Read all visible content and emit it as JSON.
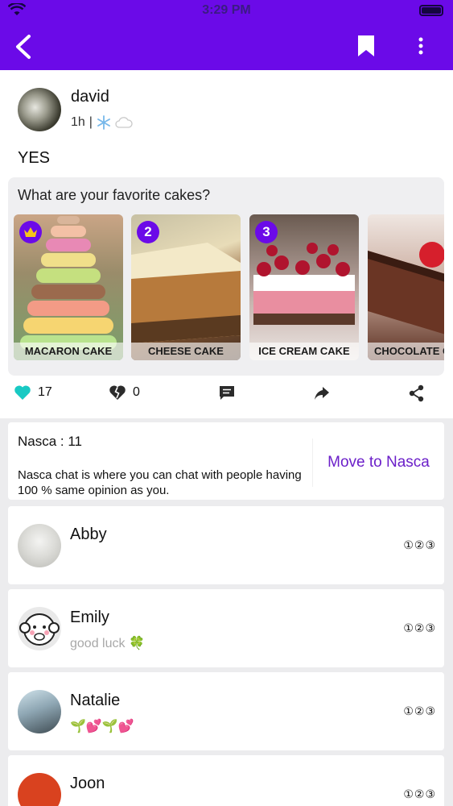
{
  "status_bar": {
    "time": "3:29 PM"
  },
  "nav": {
    "back_icon": "chevron-left-icon",
    "bookmark_icon": "bookmark-icon",
    "more_icon": "more-vertical-icon"
  },
  "post": {
    "author": "david",
    "time": "1h",
    "separator": "|",
    "weather_icons": [
      "snowflake-icon",
      "cloud-icon"
    ],
    "text": "YES"
  },
  "poll": {
    "question": "What are your favorite cakes?",
    "options": [
      {
        "label": "MACARON  CAKE",
        "rank": "crown"
      },
      {
        "label": "CHEESE  CAKE",
        "rank": "2"
      },
      {
        "label": "ICE CREAM CAKE",
        "rank": "3"
      },
      {
        "label": "CHOCOLATE  C",
        "rank": ""
      }
    ]
  },
  "actions": {
    "likes": "17",
    "dislikes": "0"
  },
  "nasca": {
    "title": "Nasca : 11",
    "description": "Nasca chat is where you can chat with people having 100 % same opinion as you.",
    "move_label": "Move to Nasca"
  },
  "users": [
    {
      "name": "Abby",
      "status": "",
      "ranks": "①②③"
    },
    {
      "name": "Emily",
      "status": "good luck 🍀",
      "ranks": "①②③"
    },
    {
      "name": "Natalie",
      "status": "🌱💕🌱💕",
      "ranks": "①②③"
    },
    {
      "name": "Joon",
      "status": "",
      "ranks": "①②③"
    }
  ],
  "colors": {
    "accent": "#6b0ae8",
    "like": "#18c9c3",
    "nasca_link": "#6b1fc9"
  }
}
